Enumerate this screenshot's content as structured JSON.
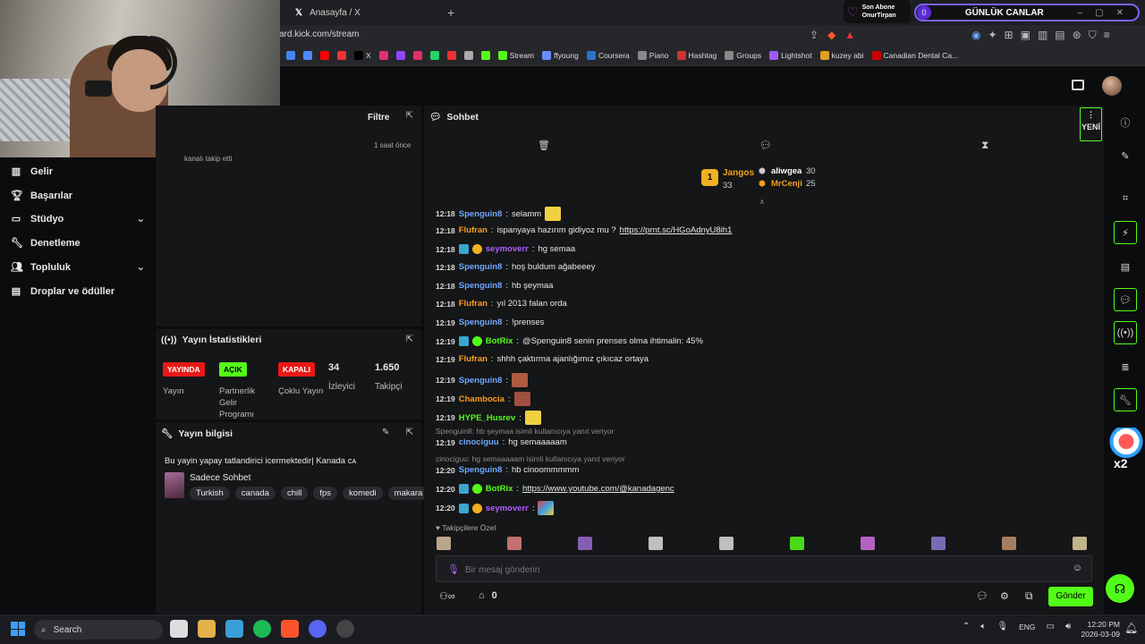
{
  "browser": {
    "tab_title": "Anasayfa / X",
    "url": "ard.kick.com/stream",
    "sub_badge": {
      "line1": "Son Abone",
      "line2": "OnurTirpan"
    },
    "goal": {
      "count": "0",
      "title": "GÜNLÜK CANLAR"
    },
    "bookmarks": [
      {
        "label": "",
        "color": "#4285f4"
      },
      {
        "label": "",
        "color": "#4a8cff"
      },
      {
        "label": "",
        "color": "#ff0000"
      },
      {
        "label": "",
        "color": "#e33"
      },
      {
        "label": "X",
        "color": "#000000"
      },
      {
        "label": "",
        "color": "#e1306c"
      },
      {
        "label": "",
        "color": "#9146ff"
      },
      {
        "label": "",
        "color": "#e1306c"
      },
      {
        "label": "",
        "color": "#25d366"
      },
      {
        "label": "",
        "color": "#e33"
      },
      {
        "label": "",
        "color": "#aaaaaa"
      },
      {
        "label": "",
        "color": "#53fc18"
      },
      {
        "label": "Stream",
        "color": "#53fc18"
      },
      {
        "label": "ffyoung",
        "color": "#6c8cff"
      },
      {
        "label": "Coursera",
        "color": "#2a73cc"
      },
      {
        "label": "Piano",
        "color": "#888888"
      },
      {
        "label": "Hashtag",
        "color": "#c33"
      },
      {
        "label": "Groups",
        "color": "#888888"
      },
      {
        "label": "Lightshot",
        "color": "#9b5cff"
      },
      {
        "label": "kuzey abi",
        "color": "#e0a020"
      },
      {
        "label": "Canadian Dental Ca...",
        "color": "#c00"
      }
    ]
  },
  "nav": {
    "items": [
      {
        "label": "Gelir",
        "icon": "chart-icon",
        "chevron": false
      },
      {
        "label": "Başarılar",
        "icon": "trophy-icon",
        "chevron": false
      },
      {
        "label": "Stüdyo",
        "icon": "studio-icon",
        "chevron": true
      },
      {
        "label": "Denetleme",
        "icon": "wrench-icon",
        "chevron": false
      },
      {
        "label": "Topluluk",
        "icon": "community-icon",
        "chevron": true
      },
      {
        "label": "Droplar ve ödüller",
        "icon": "gift-icon",
        "chevron": false
      }
    ]
  },
  "activity": {
    "filter_label": "Filtre",
    "time": "1 saat önce",
    "partial_text": "kanalı takip etti"
  },
  "stats": {
    "title": "Yayın İstatistikleri",
    "items": [
      {
        "badge": "YAYINDA",
        "badge_color": "#e91916",
        "label": "Yayın"
      },
      {
        "badge": "AÇIK",
        "badge_color": "#53fc18",
        "label": "Partnerlik Gelir Programı"
      },
      {
        "badge": "KAPALI",
        "badge_color": "#e91916",
        "label": "Çoklu Yayın"
      }
    ],
    "viewers": {
      "value": "34",
      "label": "İzleyici"
    },
    "followers": {
      "value": "1.650",
      "label": "Takipçi"
    }
  },
  "info": {
    "title": "Yayın bilgisi",
    "stream_title": "Bu yayin yapay tatlandirici icermektedir| Kanada ᴄᴀ",
    "category": "Sadece Sohbet",
    "tags": [
      "Turkish",
      "canada",
      "chill",
      "fps",
      "komedi",
      "makara"
    ]
  },
  "chat": {
    "title": "Sohbet",
    "new_label": "YENİ",
    "leaderboard": [
      {
        "name": "Jangos",
        "score": "33",
        "color": "#f0a020"
      },
      {
        "name": "aliwgea",
        "score": "30",
        "color": "#ffffff"
      },
      {
        "name": "MrCenji",
        "score": "25",
        "color": "#f0a020"
      }
    ],
    "messages": [
      {
        "time": "12:18",
        "user": "Spenguin8",
        "color": "#6fa8ff",
        "text": "selamm",
        "emote": true
      },
      {
        "time": "12:18",
        "user": "Flufran",
        "color": "#ff9f1c",
        "text": "ispanyaya hazırım gidiyoz mu ?",
        "link": "https://prnt.sc/HGoAdnyU8ih1"
      },
      {
        "time": "12:18",
        "user": "seymoverr",
        "color": "#b15cff",
        "text": "hg semaa",
        "badges": true
      },
      {
        "time": "12:18",
        "user": "Spenguin8",
        "color": "#6fa8ff",
        "text": "hoş buldum ağabeeey"
      },
      {
        "time": "12:18",
        "user": "Spenguin8",
        "color": "#6fa8ff",
        "text": "hb şeymaa"
      },
      {
        "time": "12:18",
        "user": "Flufran",
        "color": "#ff9f1c",
        "text": "yıl 2013 falan orda"
      },
      {
        "time": "12:19",
        "user": "Spenguin8",
        "color": "#6fa8ff",
        "text": "!prenses"
      },
      {
        "time": "12:19",
        "user": "BotRix",
        "color": "#53fc18",
        "text": "@Spenguin8 senin prenses olma ihtimalin: 45%",
        "bot": true
      },
      {
        "time": "12:19",
        "user": "Flufran",
        "color": "#ff9f1c",
        "text": "shhh çaktırma ajanlığımız çıkıcaz ortaya"
      },
      {
        "time": "12:19",
        "user": "Spenguin8",
        "color": "#6fa8ff",
        "text": "",
        "emote": true
      },
      {
        "time": "12:19",
        "user": "Chambocia",
        "color": "#ff9f1c",
        "text": "",
        "emote": true
      },
      {
        "time": "12:19",
        "user": "HYPE_Husrev",
        "color": "#53fc18",
        "text": "",
        "emote": true
      }
    ],
    "reply1": "Spenguin8: hb şeymaa isimli kullanıcıya yanıt veriyor",
    "msg_after_reply1": {
      "time": "12:19",
      "user": "cinociguu",
      "color": "#6fa8ff",
      "text": "hg semaaaaam"
    },
    "reply2": "cinociguu: hg semaaaaam isimli kullanıcıya yanıt veriyor",
    "msg_after_reply2": {
      "time": "12:20",
      "user": "Spenguin8",
      "color": "#6fa8ff",
      "text": "hb cinoommmmm"
    },
    "msg_botrix": {
      "time": "12:20",
      "user": "BotRix",
      "color": "#53fc18",
      "text": "https://www.youtube.com/@kanadagenc"
    },
    "msg_last": {
      "time": "12:20",
      "user": "seymoverr",
      "color": "#b15cff",
      "text": ""
    },
    "followers_only_label": "Takipçilere Özel",
    "input_placeholder": "Bir mesaj gönderin",
    "points": "0",
    "send_label": "Gönder"
  },
  "taskbar": {
    "search_label": "Search",
    "lang": "ENG",
    "time": "12:20 PM",
    "date": "2026-03-09"
  }
}
